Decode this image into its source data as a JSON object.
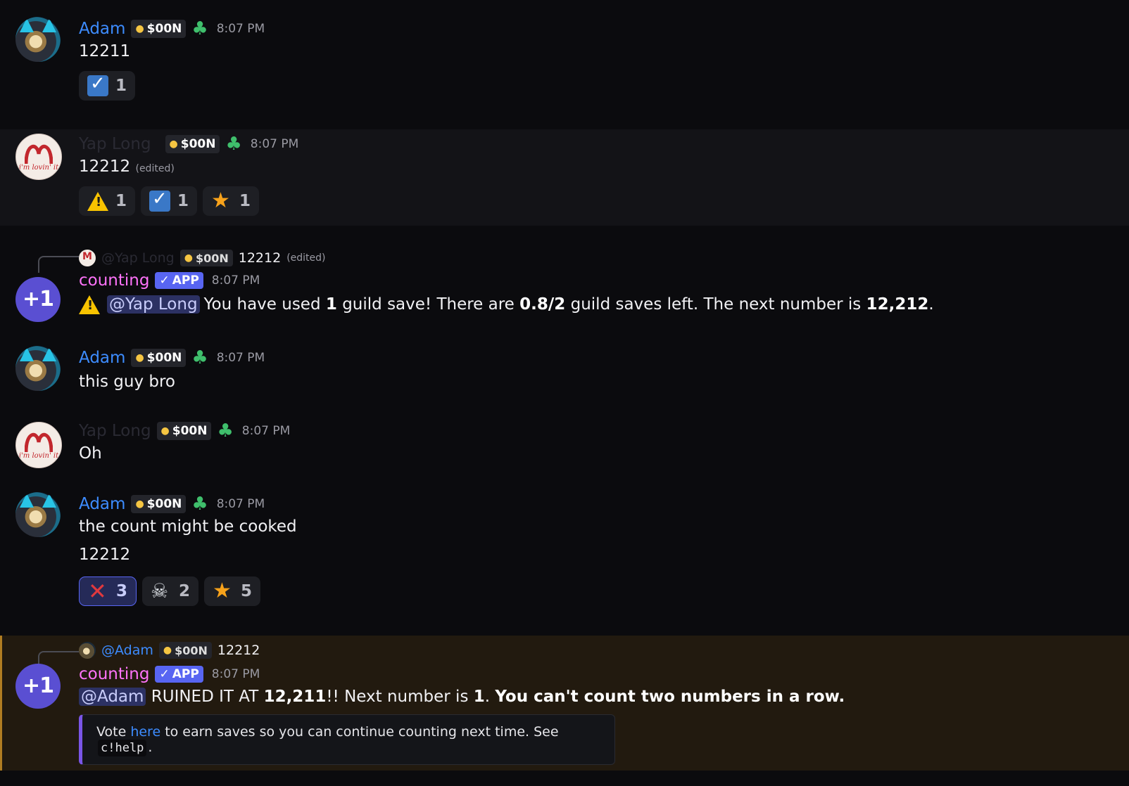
{
  "badge_tag": "$00N",
  "app_tag": "APP",
  "messages": [
    {
      "author": "Adam",
      "time": "8:07 PM",
      "lines": [
        "12211"
      ],
      "reactions": [
        {
          "emoji": "check-box-icon",
          "count": "1"
        }
      ]
    },
    {
      "author": "Yap Long",
      "time": "8:07 PM",
      "lines": [
        "12212"
      ],
      "edited": "(edited)",
      "reactions": [
        {
          "emoji": "warning-icon",
          "count": "1"
        },
        {
          "emoji": "check-box-icon",
          "count": "1"
        },
        {
          "emoji": "star-icon",
          "count": "1"
        }
      ]
    },
    {
      "author": "counting",
      "time": "8:07 PM",
      "reply": {
        "author": "@Yap Long",
        "text": "12212",
        "edited": "(edited)"
      },
      "mention": "@Yap Long",
      "text_a": "You have used ",
      "bold_a": "1",
      "text_b": " guild save! There are ",
      "bold_b": "0.8/2",
      "text_c": " guild saves left. The next number is ",
      "bold_c": "12,212",
      "text_d": "."
    },
    {
      "author": "Adam",
      "time": "8:07 PM",
      "lines": [
        "this guy bro"
      ]
    },
    {
      "author": "Yap Long",
      "time": "8:07 PM",
      "lines": [
        "Oh"
      ]
    },
    {
      "author": "Adam",
      "time": "8:07 PM",
      "lines": [
        "the count might be cooked",
        "12212"
      ],
      "reactions": [
        {
          "emoji": "cross-mark-icon",
          "count": "3"
        },
        {
          "emoji": "skull-icon",
          "count": "2"
        },
        {
          "emoji": "star-icon",
          "count": "5"
        }
      ]
    },
    {
      "author": "counting",
      "time": "8:07 PM",
      "reply": {
        "author": "@Adam",
        "text": "12212"
      },
      "mention": "@Adam",
      "text_a": " RUINED IT AT ",
      "bold_a": "12,211",
      "text_b": "!! Next number is ",
      "bold_b": "1",
      "text_c": ". ",
      "bold_c": "You can't count two numbers in a row.",
      "embed": {
        "prefix": "Vote ",
        "link": "here",
        "middle": " to earn saves so you can continue counting next time. See ",
        "code": "c!help",
        "suffix": "."
      }
    }
  ]
}
